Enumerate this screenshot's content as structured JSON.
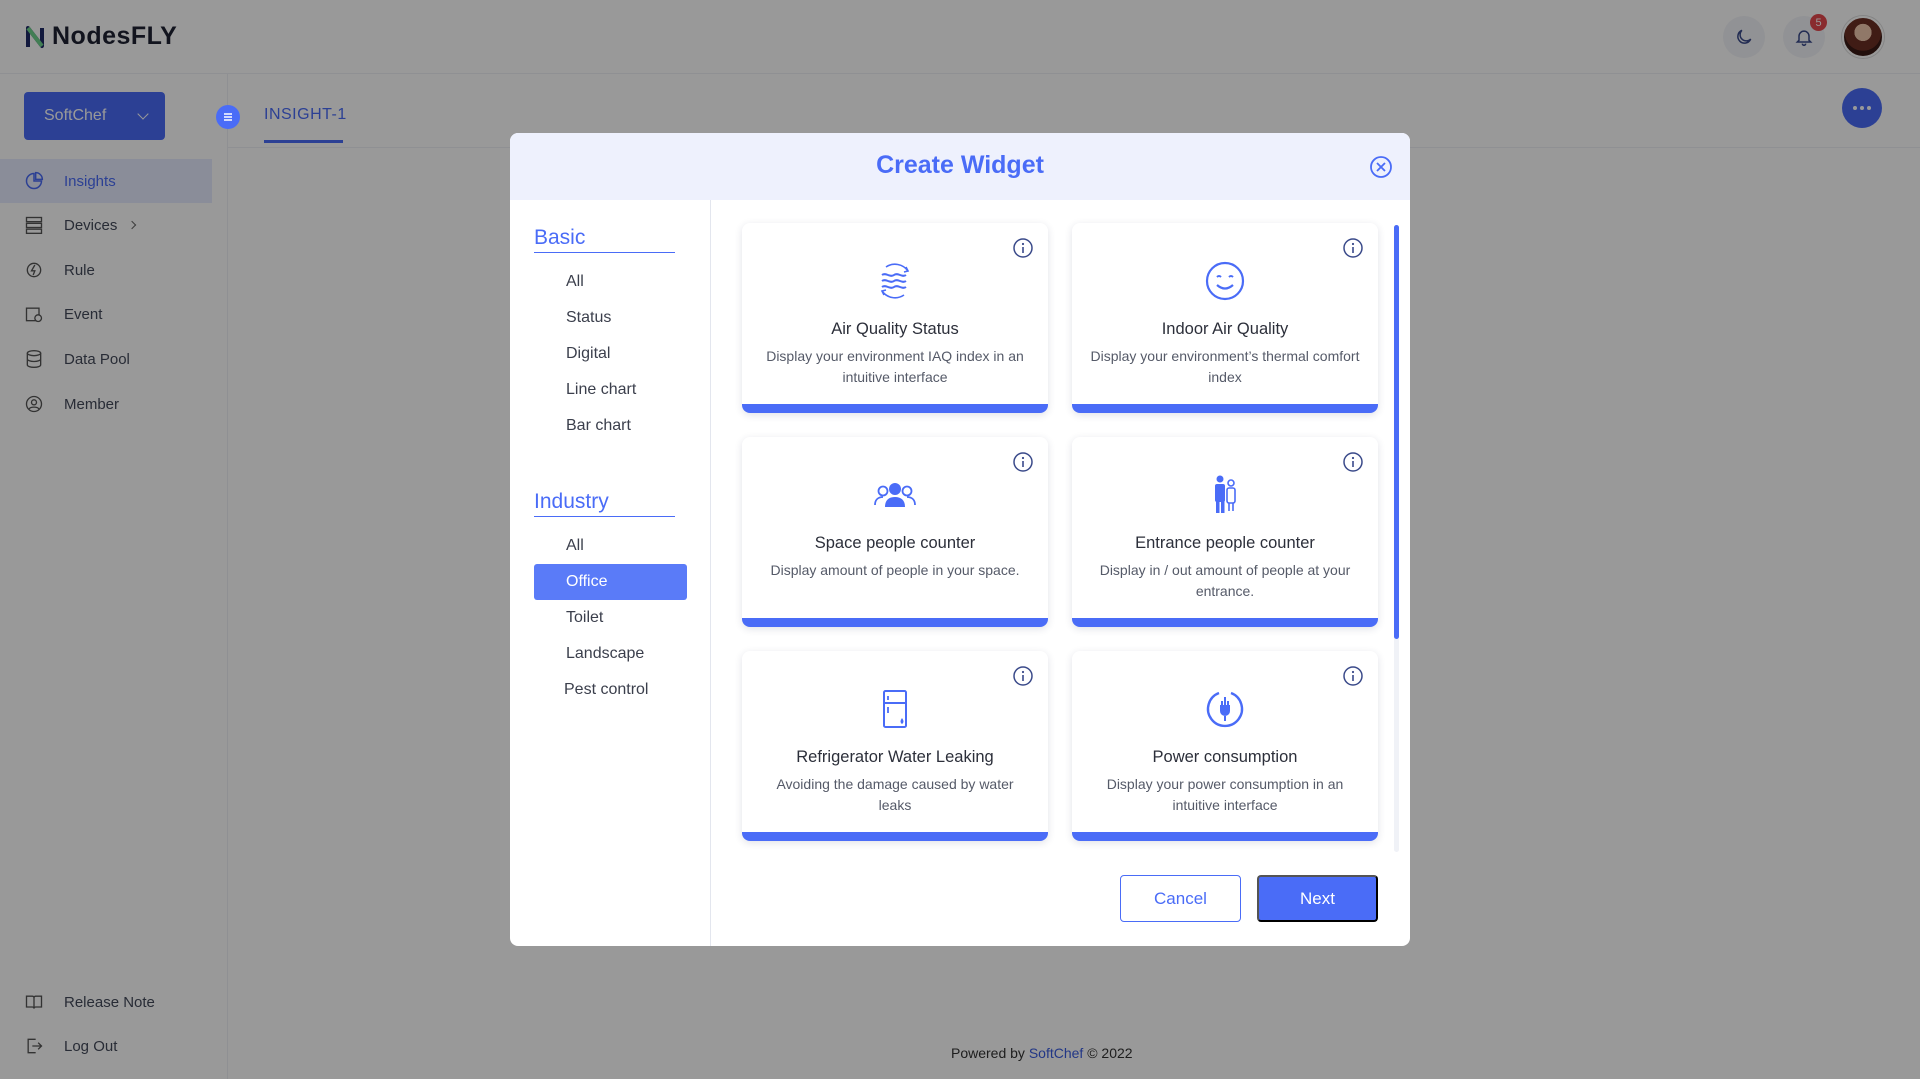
{
  "app": {
    "logo_text": "NodesFLY",
    "logo_icon": "nodesfly-logo-icon"
  },
  "header": {
    "notification_count": "5",
    "theme_icon": "moon-icon",
    "bell_icon": "bell-icon"
  },
  "sidebar": {
    "org": "SoftChef",
    "items": [
      {
        "label": "Insights",
        "icon": "pie-chart-icon"
      },
      {
        "label": "Devices",
        "icon": "server-icon"
      },
      {
        "label": "Rule",
        "icon": "rule-icon"
      },
      {
        "label": "Event",
        "icon": "event-icon"
      },
      {
        "label": "Data Pool",
        "icon": "database-icon"
      },
      {
        "label": "Member",
        "icon": "user-icon"
      }
    ],
    "bottom": [
      {
        "label": "Release Note",
        "icon": "book-icon"
      },
      {
        "label": "Log Out",
        "icon": "logout-icon"
      }
    ]
  },
  "tabs": {
    "active": "INSIGHT-1"
  },
  "footer": {
    "prefix": "Powered by",
    "brand": "SoftChef",
    "suffix": "© 2022"
  },
  "modal": {
    "title": "Create Widget",
    "basic_title": "Basic",
    "basic_items": [
      "All",
      "Status",
      "Digital",
      "Line chart",
      "Bar chart"
    ],
    "industry_title": "Industry",
    "industry_items": [
      "All",
      "Office",
      "Toilet",
      "Landscape",
      "Pest control"
    ],
    "selected_industry": "Office",
    "cards": [
      {
        "title": "Air Quality Status",
        "desc": "Display your environment IAQ index in an intuitive interface",
        "icon": "air-quality-icon"
      },
      {
        "title": "Indoor Air Quality",
        "desc": "Display your environment’s thermal comfort index",
        "icon": "smile-icon"
      },
      {
        "title": "Space people counter",
        "desc": "Display amount of people in your space.",
        "icon": "people-group-icon"
      },
      {
        "title": "Entrance people counter",
        "desc": "Display in / out amount of people at your entrance.",
        "icon": "entrance-people-icon"
      },
      {
        "title": "Refrigerator Water Leaking",
        "desc": "Avoiding the damage caused by water leaks",
        "icon": "refrigerator-icon"
      },
      {
        "title": "Power consumption",
        "desc": "Display your power consumption in an intuitive interface",
        "icon": "power-plug-icon"
      }
    ],
    "cancel_label": "Cancel",
    "next_label": "Next"
  },
  "colors": {
    "accent": "#4a6cf7",
    "overlay": "rgba(0,0,0,0.40)"
  }
}
